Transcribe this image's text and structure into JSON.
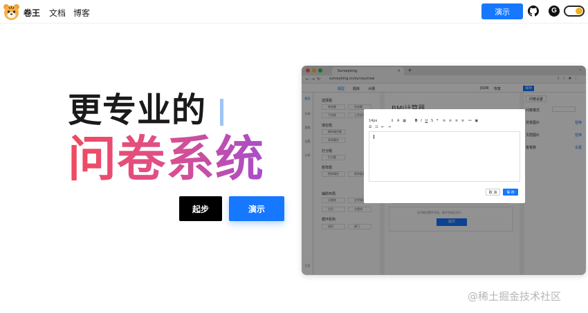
{
  "navbar": {
    "brand": "卷王",
    "docs": "文档",
    "blog": "博客",
    "demo_button": "演示",
    "gitee_glyph": "G"
  },
  "hero": {
    "line1": "更专业的",
    "line2": "问卷系统",
    "start_button": "起步",
    "demo_button": "演示"
  },
  "screenshot": {
    "tab_title": "Surveyking",
    "url": "surveyking.cn/survey/new",
    "app_tabs": [
      "题型",
      "题库",
      "大纲"
    ],
    "app_right": [
      "JSON",
      "恢复",
      "保存"
    ],
    "rail": [
      "题型",
      "外观",
      "逻辑",
      "设置",
      "分享",
      "主页"
    ],
    "palette": {
      "groups": [
        "选择题",
        "填空题",
        "打分题",
        "矩阵题",
        "辅助布局",
        "循环机构"
      ],
      "items": [
        [
          "单选题",
          "多选题"
        ],
        [
          "下拉框",
          "上传文件"
        ],
        [
          "横向填空题",
          "多项填空"
        ],
        [
          "多项填空",
          ""
        ],
        [
          "打分题",
          ""
        ],
        [
          "矩阵填空",
          "矩阵量表"
        ],
        [
          "分隔线",
          "文字描述"
        ],
        [
          "分页",
          "分割线"
        ],
        [
          "成员",
          "部门"
        ]
      ]
    },
    "form_title": "BMI计算器",
    "settings": {
      "tab": "问卷设置",
      "labels": [
        "问卷模式",
        "背景图片",
        "页眉图片",
        "答卷数"
      ],
      "links": [
        "替换",
        "替换",
        "设置"
      ]
    },
    "dialog": {
      "font_size": "14px",
      "cancel": "取 消",
      "save": "保 存"
    },
    "submit_hint": "在问卷设置中开启，填写完成后显示",
    "submit_button": "提交"
  },
  "watermark": "@稀土掘金技术社区",
  "colors": {
    "accent": "#1677ff",
    "gradient_start": "#f04a5e",
    "gradient_end": "#a74ecb"
  }
}
